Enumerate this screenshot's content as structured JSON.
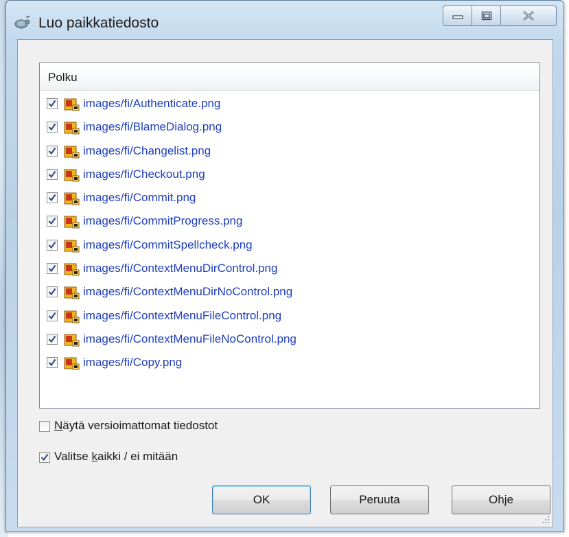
{
  "window": {
    "title": "Luo paikkatiedosto",
    "minimize_label": "Minimize",
    "maximize_label": "Maximize",
    "close_label": "Close"
  },
  "list": {
    "column_header": "Polku",
    "items": [
      {
        "path": "images/fi/Authenticate.png",
        "checked": true
      },
      {
        "path": "images/fi/BlameDialog.png",
        "checked": true
      },
      {
        "path": "images/fi/Changelist.png",
        "checked": true
      },
      {
        "path": "images/fi/Checkout.png",
        "checked": true
      },
      {
        "path": "images/fi/Commit.png",
        "checked": true
      },
      {
        "path": "images/fi/CommitProgress.png",
        "checked": true
      },
      {
        "path": "images/fi/CommitSpellcheck.png",
        "checked": true
      },
      {
        "path": "images/fi/ContextMenuDirControl.png",
        "checked": true
      },
      {
        "path": "images/fi/ContextMenuDirNoControl.png",
        "checked": true
      },
      {
        "path": "images/fi/ContextMenuFileControl.png",
        "checked": true
      },
      {
        "path": "images/fi/ContextMenuFileNoControl.png",
        "checked": true
      },
      {
        "path": "images/fi/Copy.png",
        "checked": true
      }
    ]
  },
  "options": {
    "show_unversioned": {
      "pre": "",
      "accel": "N",
      "post": "äytä versioimattomat tiedostot",
      "checked": false
    },
    "select_all": {
      "pre": "Valitse ",
      "accel": "k",
      "post": "aikki / ei mitään",
      "checked": true
    }
  },
  "buttons": {
    "ok": "OK",
    "cancel": "Peruuta",
    "help": "Ohje"
  },
  "colors": {
    "link_text": "#1f3fbf",
    "check_mark": "#3a4f8a",
    "file_icon_red": "#c8361c",
    "file_icon_yellow": "#f3b51c"
  },
  "icons": {
    "app": "tortoise-icon",
    "file": "modified-image-file-icon",
    "check": "checkmark-icon"
  }
}
